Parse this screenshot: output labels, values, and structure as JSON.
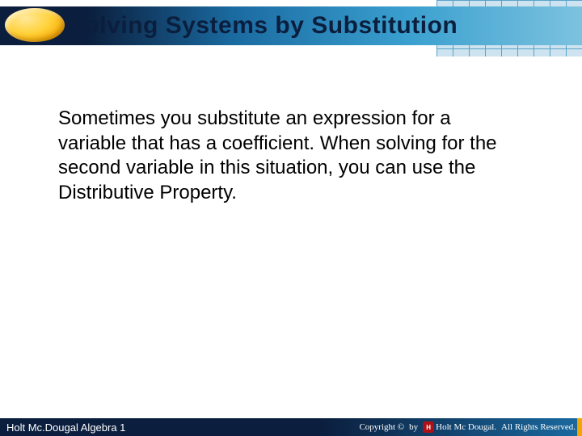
{
  "header": {
    "title": "Solving Systems by Substitution"
  },
  "body": {
    "paragraph": "Sometimes you substitute an expression for a variable that has a coefficient. When solving for the second variable in this situation, you can use the Distributive Property."
  },
  "footer": {
    "left": "Holt Mc.Dougal Algebra 1",
    "copyright_label": "Copyright ©",
    "publisher_by": "by",
    "publisher_name": "Holt Mc Dougal.",
    "rights": "All Rights Reserved."
  }
}
